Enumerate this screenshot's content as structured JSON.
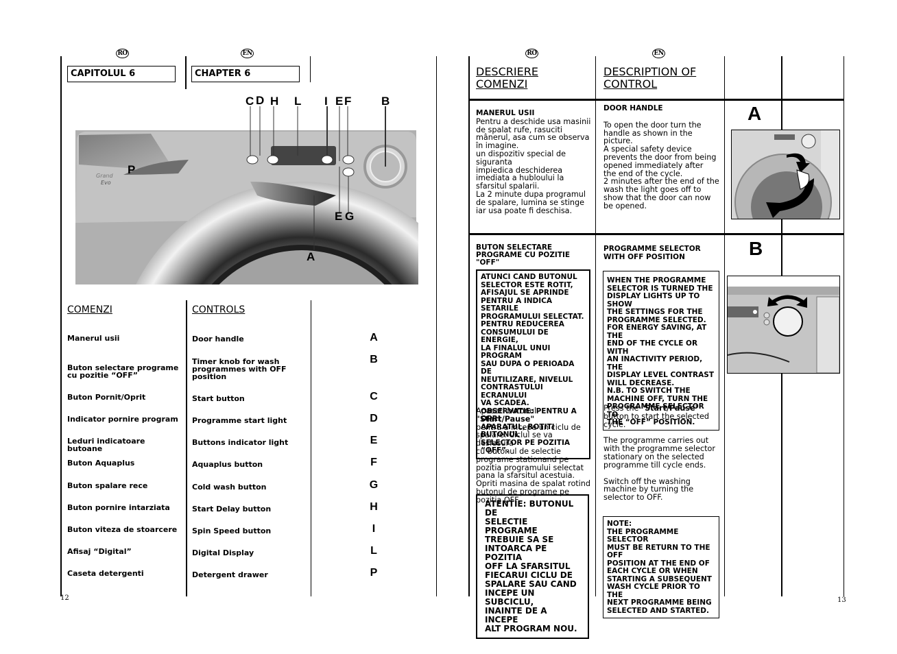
{
  "left_page": {
    "lang_ro": "RO",
    "lang_en": "EN",
    "chapter_ro": "CAPITOLUL 6",
    "chapter_en": "CHAPTER 6",
    "diagram": {
      "brand": "Grand Evo",
      "callouts_top": [
        "C",
        "D",
        "H",
        "L",
        "I",
        "E",
        "F",
        "B"
      ],
      "callouts_bottom": [
        "E",
        "G"
      ],
      "callout_p": "P",
      "callout_a": "A"
    },
    "controls_heading_ro": "COMENZI",
    "controls_heading_en": "CONTROLS",
    "controls": [
      {
        "ro": "Manerul usii",
        "en": "Door handle",
        "key": "A"
      },
      {
        "ro": "Buton selectare programe cu pozitie “OFF”",
        "en": "Timer knob for wash programmes with OFF position",
        "key": "B"
      },
      {
        "ro": "Buton Pornit/Oprit",
        "en": "Start button",
        "key": "C"
      },
      {
        "ro": "Indicator pornire program",
        "en": "Programme start light",
        "key": "D"
      },
      {
        "ro": "Leduri indicatoare butoane",
        "en": "Buttons indicator light",
        "key": "E"
      },
      {
        "ro": "Buton Aquaplus",
        "en": "Aquaplus button",
        "key": "F"
      },
      {
        "ro": "Buton spalare rece",
        "en": "Cold wash button",
        "key": "G"
      },
      {
        "ro": "Buton pornire intarziata",
        "en": "Start Delay button",
        "key": "H"
      },
      {
        "ro": "Buton viteza de stoarcere",
        "en": "Spin Speed button",
        "key": "I"
      },
      {
        "ro": "Afisaj “Digital”",
        "en": "Digital Display",
        "key": "L"
      },
      {
        "ro": "Caseta detergenti",
        "en": "Detergent drawer",
        "key": "P"
      }
    ],
    "page_number": "12"
  },
  "right_page": {
    "lang_ro": "RO",
    "lang_en": "EN",
    "heading_ro_1": "DESCRIERE",
    "heading_ro_2": "COMENZI",
    "heading_en_1": "DESCRIPTION OF",
    "heading_en_2": "CONTROL",
    "section_a": {
      "figure_label": "A",
      "title_ro": "MANERUL USII",
      "text_ro": [
        "Pentru a deschide usa masinii",
        "de spalat rufe, rasuciti",
        "mânerul, asa cum se observa",
        "în imagine.",
        "un dispozitiv special de",
        "siguranta",
        "impiedica deschiderea",
        "imediata a hubloului la",
        "sfarsitul spalarii.",
        "La 2 minute dupa programul",
        "de spalare, lumina se stinge",
        "iar usa poate fi deschisa."
      ],
      "title_en": "DOOR HANDLE",
      "text_en": [
        "To open the door turn the",
        "handle as shown in the",
        "picture.",
        "A special safety device",
        "prevents the door from being",
        "opened immediately after",
        "the end of the cycle.",
        "2 minutes after the end of the",
        "wash the light goes off to",
        "show that the door can now",
        "be opened."
      ]
    },
    "section_b": {
      "figure_label": "B",
      "title_ro": "BUTON SELECTARE PROGRAME CU POZITIE \"OFF\"",
      "box_ro": [
        "ATUNCI CAND BUTONUL",
        "SELECTOR ESTE ROTIT,",
        "AFISAJUL SE APRINDE",
        "PENTRU A INDICA SETARILE",
        "PROGRAMULUI SELECTAT.",
        "PENTRU REDUCEREA",
        "CONSUMULUI DE ENERGIE,",
        "LA FINALUL UNUI PROGRAM",
        "SAU DUPA O PERIOADA DE",
        "NEUTILIZARE, NIVELUL",
        "CONTRASTULUI ECRANULUI",
        "VA SCADEA.",
        "OBSERVATIE: PENTRU A OPRI",
        "APARATUL, ROTITI BUTONUL",
        "SELECTOR PE POZITIA “OFF”."
      ],
      "title_en": "PROGRAMME SELECTOR WITH OFF POSITION",
      "box_en": [
        "WHEN THE PROGRAMME",
        "SELECTOR IS TURNED THE",
        "DISPLAY LIGHTS UP TO SHOW",
        "THE SETTINGS FOR THE",
        "PROGRAMME SELECTED.",
        "FOR ENERGY SAVING, AT THE",
        "END OF THE CYCLE OR WITH",
        "AN INACTIVITY PERIOD, THE",
        "DISPLAY LEVEL CONTRAST",
        "WILL DECREASE.",
        "N.B. TO SWITCH THE",
        "MACHINE OFF, TURN THE",
        "PROGRAMME SELECTOR TO",
        "THE “OFF” POSITION."
      ],
      "para_ro_pre": "Apasati butonul ",
      "para_ro_bold": "\"Start/Pause\"",
      "para_ro_post": [
        "pentru a incepe un ciclu de",
        "spalare. Ciclul se va desfasura",
        "cu butonul de selectie",
        "programe stationand pe",
        "pozitia programului selectat",
        "pana la sfarsitul acestuia.",
        "Opriti masina de spalat rotind",
        "butonul de programe pe",
        "pozitia OFF."
      ],
      "para_en_pre": "Press the \"",
      "para_en_bold": "Start/Pause",
      "para_en_post1": "\"",
      "para_en_lines": [
        "button to start the selected",
        "cycle."
      ],
      "para_en_2": [
        "The programme carries out",
        "with the programme selector",
        "stationary on the selected",
        "programme till cycle ends."
      ],
      "para_en_3": [
        "Switch off the washing",
        "machine by turning the",
        "selector to OFF."
      ],
      "warn_ro": [
        "ATENTIE: BUTONUL DE",
        "SELECTIE PROGRAME",
        "TREBUIE SA SE",
        "INTOARCA PE POZITIA",
        "OFF LA SFARSITUL",
        "FIECARUI CICLU DE",
        "SPALARE SAU CAND",
        "INCEPE UN SUBCICLU,",
        "INAINTE DE A INCEPE",
        "ALT PROGRAM NOU."
      ],
      "note_en": [
        "NOTE:",
        "THE PROGRAMME SELECTOR",
        "MUST BE RETURN TO THE OFF",
        "POSITION AT THE END OF",
        "EACH CYCLE OR WHEN",
        "STARTING A SUBSEQUENT",
        "WASH CYCLE PRIOR TO THE",
        "NEXT PROGRAMME BEING",
        "SELECTED AND STARTED."
      ]
    },
    "page_number": "13"
  }
}
